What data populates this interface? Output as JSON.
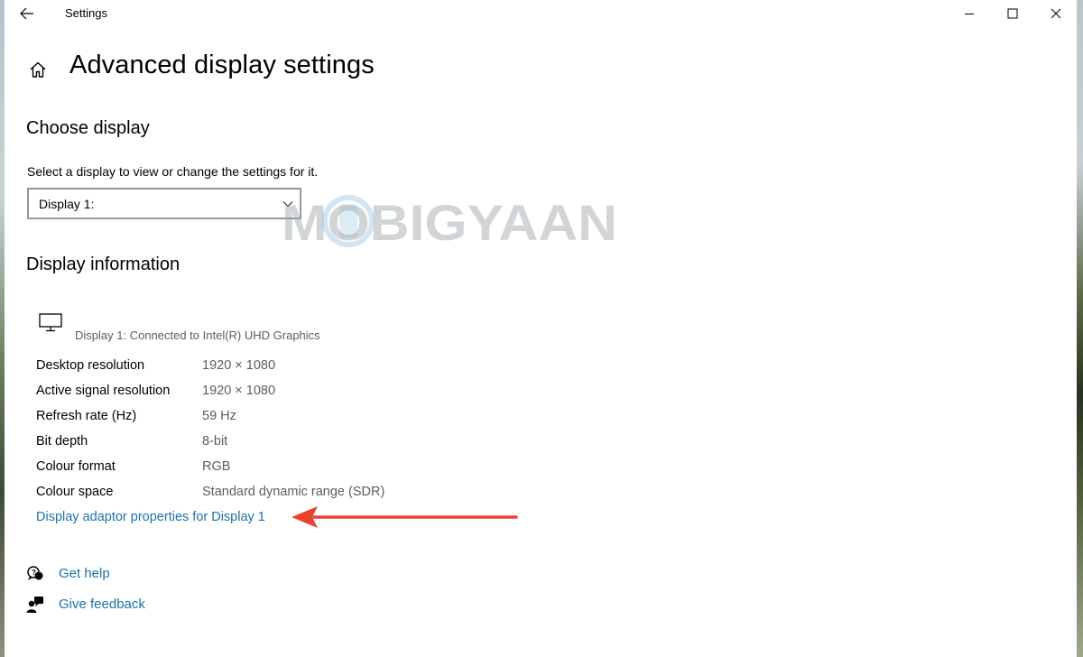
{
  "window": {
    "title": "Settings"
  },
  "page": {
    "title": "Advanced display settings"
  },
  "choose_display": {
    "heading": "Choose display",
    "description": "Select a display to view or change the settings for it.",
    "selected": "Display 1:"
  },
  "watermark": {
    "text": "MOBIGYAAN"
  },
  "display_info": {
    "heading": "Display information",
    "connected": "Display 1: Connected to Intel(R) UHD Graphics",
    "rows": [
      {
        "label": "Desktop resolution",
        "value": "1920 × 1080"
      },
      {
        "label": "Active signal resolution",
        "value": "1920 × 1080"
      },
      {
        "label": "Refresh rate (Hz)",
        "value": "59 Hz"
      },
      {
        "label": "Bit depth",
        "value": "8-bit"
      },
      {
        "label": "Colour format",
        "value": "RGB"
      },
      {
        "label": "Colour space",
        "value": "Standard dynamic range (SDR)"
      }
    ],
    "adaptor_link": "Display adaptor properties for Display 1"
  },
  "help": {
    "get_help": "Get help",
    "give_feedback": "Give feedback"
  },
  "colors": {
    "link": "#1a73a8",
    "secondary_text": "#5d5d5d",
    "arrow": "#e8432e"
  },
  "icons": {
    "back": "arrow-left-icon",
    "home": "home-icon",
    "monitor": "monitor-icon",
    "help": "chat-help-icon",
    "feedback": "feedback-person-icon"
  }
}
